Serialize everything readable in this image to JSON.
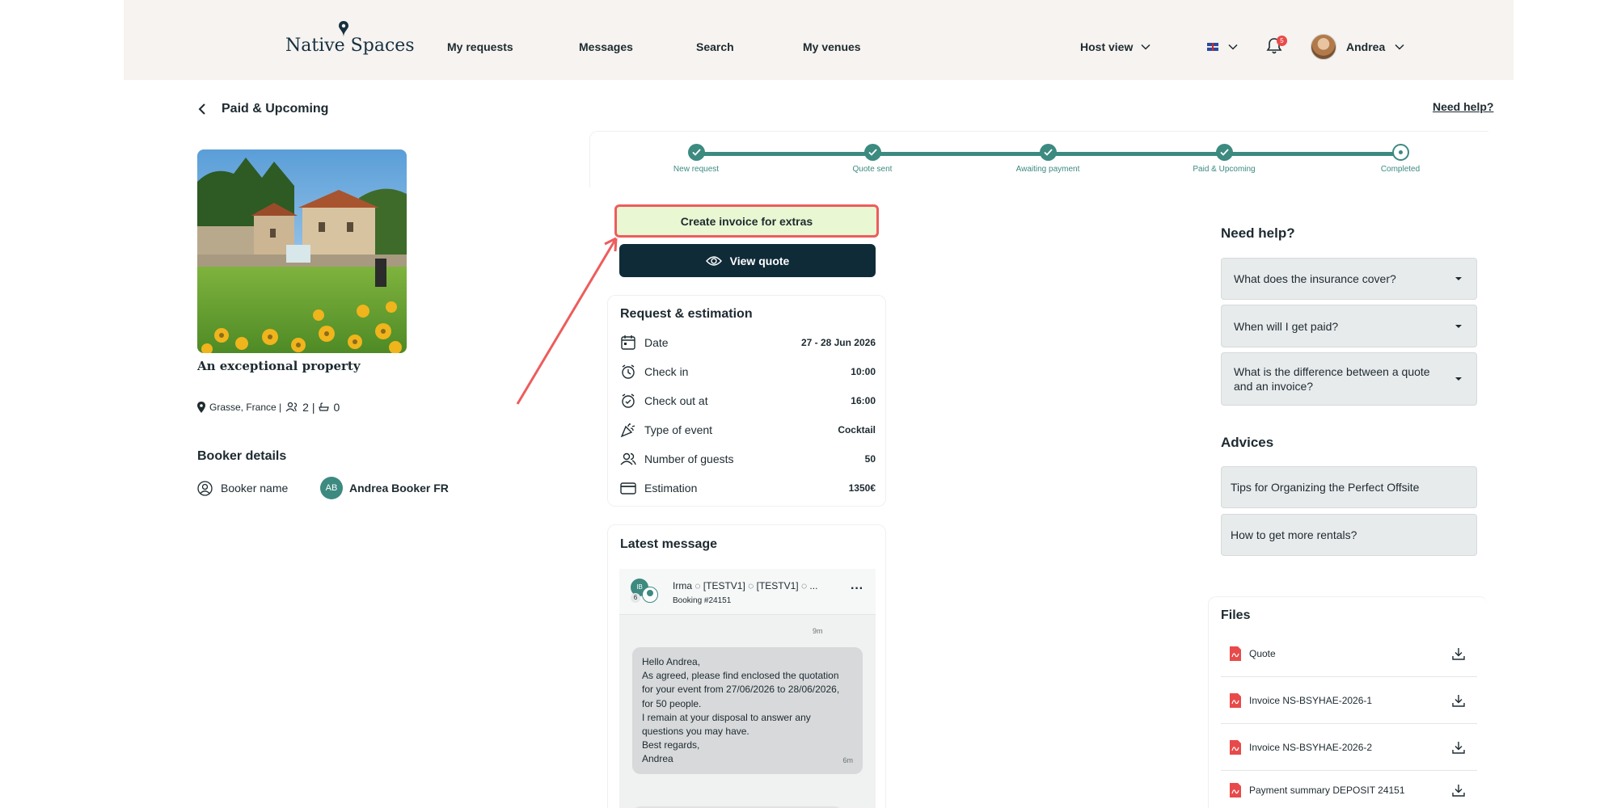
{
  "header": {
    "logo": "Native Spaces",
    "nav": [
      "My requests",
      "Messages",
      "Search",
      "My venues"
    ],
    "host_view": "Host view",
    "notifications_count": "5",
    "user_name": "Andrea"
  },
  "page": {
    "back_title": "Paid & Upcoming",
    "need_help_link": "Need help?"
  },
  "venue": {
    "name": "An exceptional property",
    "location": "Grasse, France |",
    "rooms": "2 |",
    "bathrooms": "0"
  },
  "booker": {
    "title": "Booker details",
    "label": "Booker name",
    "initials": "AB",
    "name": "Andrea Booker FR"
  },
  "progress": {
    "steps": [
      "New request",
      "Quote sent",
      "Awaiting payment",
      "Paid & Upcoming",
      "Completed"
    ]
  },
  "actions": {
    "create_invoice": "Create invoice for extras",
    "view_quote": "View quote"
  },
  "request": {
    "title": "Request & estimation",
    "rows": [
      {
        "label": "Date",
        "value": "27 - 28 Jun 2026"
      },
      {
        "label": "Check in",
        "value": "10:00"
      },
      {
        "label": "Check out at",
        "value": "16:00"
      },
      {
        "label": "Type of event",
        "value": "Cocktail"
      },
      {
        "label": "Number of guests",
        "value": "50"
      },
      {
        "label": "Estimation",
        "value": "1350€"
      }
    ]
  },
  "message": {
    "title": "Latest message",
    "avatar_initials": "IB",
    "participant_count": "6",
    "participants": "Irma ◌  [TESTV1] ◌  [TESTV1] ◌  ...",
    "booking": "Booking #24151",
    "time_top": "9m",
    "lines": [
      "Hello Andrea,",
      "As agreed, please find enclosed the quotation",
      "for your event from 27/06/2026 to 28/06/2026,",
      "for 50 people.",
      "I remain at your disposal to answer any",
      "questions you may have.",
      "Best regards,",
      "Andrea"
    ],
    "time_bottom": "6m"
  },
  "help": {
    "title": "Need help?",
    "faqs": [
      "What does the insurance cover?",
      "When will I get paid?",
      "What is the difference between a quote and an invoice?"
    ]
  },
  "advices": {
    "title": "Advices",
    "items": [
      "Tips for Organizing the Perfect Offsite",
      "How to get more rentals?"
    ]
  },
  "files": {
    "title": "Files",
    "items": [
      "Quote",
      "Invoice NS-BSYHAE-2026-1",
      "Invoice NS-BSYHAE-2026-2",
      "Payment summary DEPOSIT 24151"
    ]
  },
  "colors": {
    "brand": "#3c8a80",
    "dark_button": "#0f2b38",
    "highlight": "#ee5c5c",
    "highlight_fill": "#e9f7d2",
    "header_bg": "#f6f3f0"
  }
}
